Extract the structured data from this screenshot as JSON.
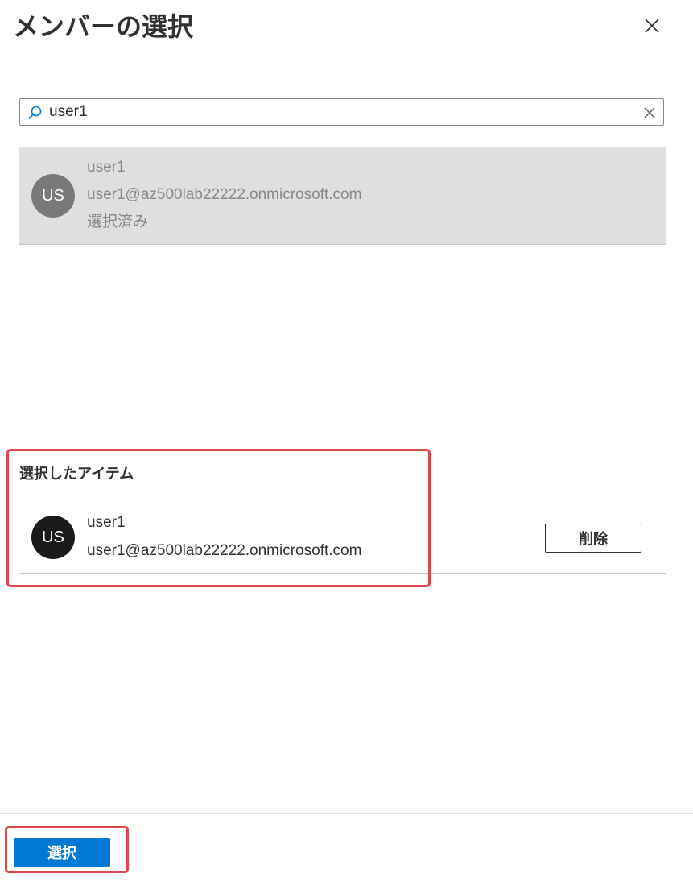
{
  "header": {
    "title": "メンバーの選択"
  },
  "search": {
    "value": "user1"
  },
  "results": [
    {
      "initials": "US",
      "name": "user1",
      "email": "user1@az500lab22222.onmicrosoft.com",
      "status": "選択済み"
    }
  ],
  "selected": {
    "heading": "選択したアイテム",
    "items": [
      {
        "initials": "US",
        "name": "user1",
        "email": "user1@az500lab22222.onmicrosoft.com",
        "remove_label": "削除"
      }
    ]
  },
  "footer": {
    "select_label": "選択"
  },
  "colors": {
    "accent": "#0078d4",
    "highlight": "#e0474c",
    "selected_row_bg": "#e1dfdd"
  },
  "icons": {
    "close": "close-icon",
    "search": "search-icon",
    "clear": "clear-icon"
  }
}
